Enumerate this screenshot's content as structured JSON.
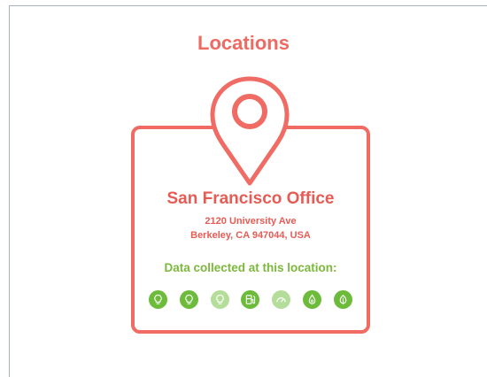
{
  "page": {
    "title": "Locations"
  },
  "location": {
    "name": "San Francisco Office",
    "address_line1": "2120 University Ave",
    "address_line2": "Berkeley, CA 947044, USA",
    "data_label": "Data collected at this location:"
  },
  "colors": {
    "accent": "#ef6b63",
    "green": "#6dbb3a",
    "green_light": "#b4dd9a"
  },
  "data_icons": [
    {
      "icon": "lightbulb-icon",
      "state": "active"
    },
    {
      "icon": "lightbulb-icon",
      "state": "active"
    },
    {
      "icon": "lightbulb-icon",
      "state": "inactive"
    },
    {
      "icon": "fuel-pump-icon",
      "state": "active"
    },
    {
      "icon": "gauge-icon",
      "state": "inactive"
    },
    {
      "icon": "water-drop-icon",
      "state": "active"
    },
    {
      "icon": "leaf-icon",
      "state": "active"
    }
  ]
}
